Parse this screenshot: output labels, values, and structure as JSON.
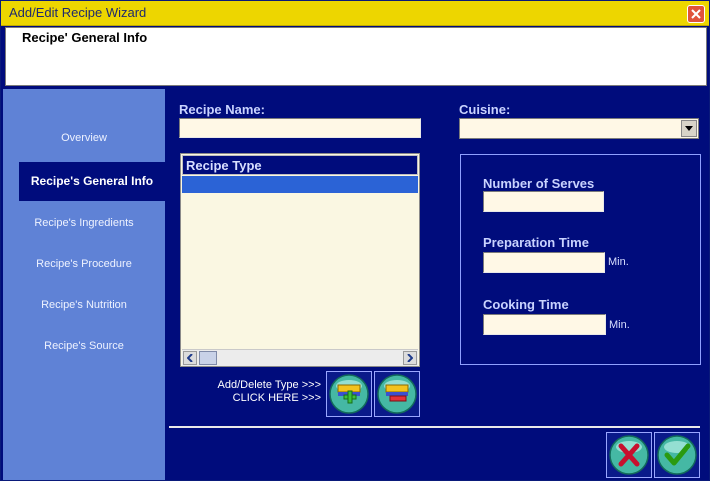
{
  "window": {
    "title": "Add/Edit Recipe Wizard",
    "step_header": "Recipe' General Info"
  },
  "sidebar": {
    "items": [
      {
        "label": "Overview",
        "active": false
      },
      {
        "label": "Recipe's General Info",
        "active": true
      },
      {
        "label": "Recipe's Ingredients",
        "active": false
      },
      {
        "label": "Recipe's Procedure",
        "active": false
      },
      {
        "label": "Recipe's Nutrition",
        "active": false
      },
      {
        "label": "Recipe's Source",
        "active": false
      }
    ]
  },
  "form": {
    "recipe_name": {
      "label": "Recipe Name:",
      "value": ""
    },
    "cuisine": {
      "label": "Cuisine:",
      "value": ""
    },
    "recipe_type": {
      "header": "Recipe Type",
      "items": []
    },
    "serves": {
      "label": "Number of Serves",
      "value": ""
    },
    "prep_time": {
      "label": "Preparation Time",
      "value": "",
      "unit": "Min."
    },
    "cook_time": {
      "label": "Cooking Time",
      "value": "",
      "unit": "Min."
    },
    "add_delete": {
      "line1": "Add/Delete Type >>>",
      "line2": "CLICK HERE    >>>"
    }
  },
  "icons": {
    "add_type": "add-type-icon",
    "delete_type": "delete-type-icon",
    "cancel": "cancel-x-icon",
    "ok": "ok-check-icon"
  },
  "colors": {
    "background": "#000c7c",
    "sidebar": "#5f82d6",
    "title_bar": "#edd600",
    "input_fill": "#fff8e6"
  }
}
